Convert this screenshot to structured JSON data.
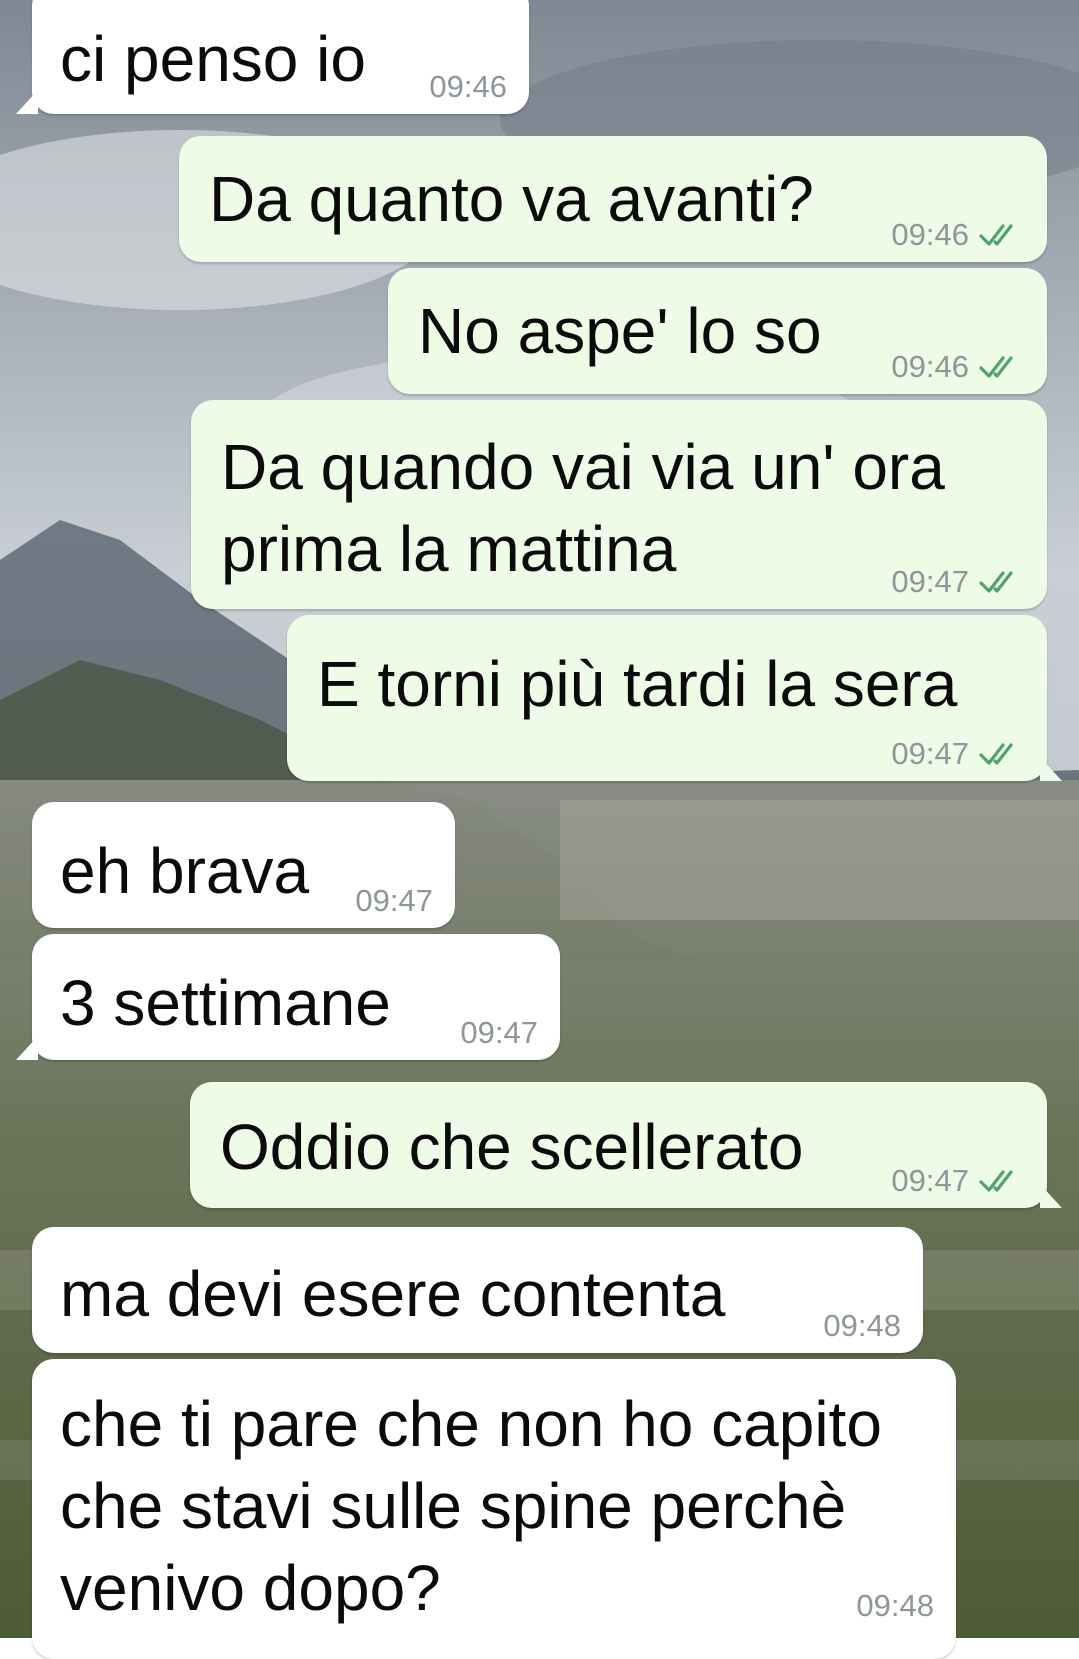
{
  "chat": {
    "messages": [
      {
        "direction": "in",
        "text": "ci penso io",
        "time": "09:46"
      },
      {
        "direction": "out",
        "text": "Da quanto va avanti?",
        "time": "09:46",
        "status": "read"
      },
      {
        "direction": "out",
        "text": "No aspe' lo so",
        "time": "09:46",
        "status": "read"
      },
      {
        "direction": "out",
        "text": "Da quando vai via un' ora prima la mattina",
        "time": "09:47",
        "status": "read"
      },
      {
        "direction": "out",
        "text": "E torni più tardi la sera",
        "time": "09:47",
        "status": "read"
      },
      {
        "direction": "in",
        "text": "eh brava",
        "time": "09:47"
      },
      {
        "direction": "in",
        "text": "3 settimane",
        "time": "09:47"
      },
      {
        "direction": "out",
        "text": "Oddio che scellerato",
        "time": "09:47",
        "status": "read"
      },
      {
        "direction": "in",
        "text": "ma devi esere contenta",
        "time": "09:48"
      },
      {
        "direction": "in",
        "text": "che ti pare che non ho capito che stavi sulle spine perchè venivo dopo?",
        "time": "09:48"
      }
    ]
  },
  "colors": {
    "incoming_bubble": "#ffffff",
    "outgoing_bubble": "#eefbe6",
    "timestamp": "#8e969a",
    "read_ticks": "#4fa36a"
  },
  "icons": {
    "read_status": "double-check-icon"
  }
}
